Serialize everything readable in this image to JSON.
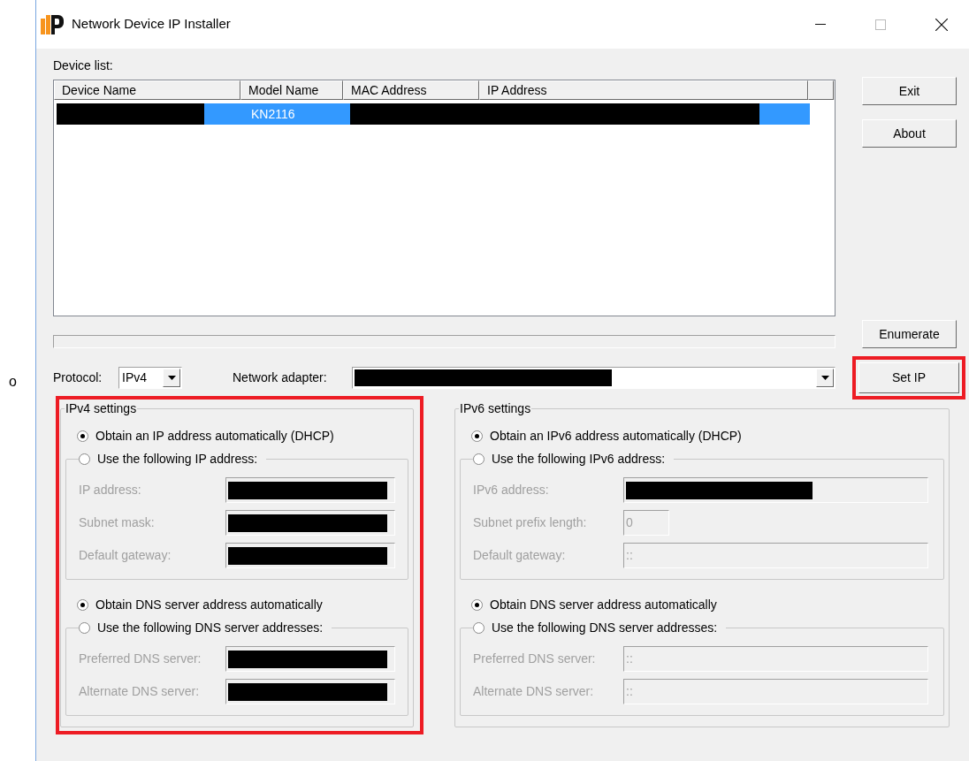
{
  "margin_mark": "o",
  "window": {
    "title": "Network Device IP Installer"
  },
  "device_list": {
    "label": "Device list:",
    "columns": [
      "Device Name",
      "Model Name",
      "MAC Address",
      "IP Address"
    ],
    "rows": [
      {
        "selected": true,
        "cells": [
          {
            "redacted": true
          },
          {
            "text": "KN2116"
          },
          {
            "redacted": true
          },
          {
            "redacted": true
          }
        ]
      }
    ]
  },
  "side_buttons": [
    {
      "label": "Exit"
    },
    {
      "label": "About"
    }
  ],
  "enumerate_button": {
    "label": "Enumerate"
  },
  "protocol": {
    "label": "Protocol:",
    "value": "IPv4"
  },
  "network_adapter": {
    "label": "Network adapter:",
    "redacted": true
  },
  "set_ip_button": {
    "label": "Set IP",
    "highlighted": true
  },
  "ipv4_settings": {
    "title": "IPv4 settings",
    "highlighted": true,
    "address_options": [
      {
        "label": "Obtain an IP address automatically (DHCP)",
        "selected": true
      },
      {
        "label": "Use the following IP address:",
        "selected": false
      }
    ],
    "address_fields": [
      {
        "label": "IP address:",
        "disabled": true,
        "redacted": true
      },
      {
        "label": "Subnet mask:",
        "disabled": true,
        "redacted": true
      },
      {
        "label": "Default gateway:",
        "disabled": true,
        "redacted": true
      }
    ],
    "dns_options": [
      {
        "label": "Obtain DNS server address automatically",
        "selected": true
      },
      {
        "label": "Use the following DNS server addresses:",
        "selected": false
      }
    ],
    "dns_fields": [
      {
        "label": "Preferred DNS server:",
        "disabled": true,
        "redacted": true
      },
      {
        "label": "Alternate DNS server:",
        "disabled": true,
        "redacted": true
      }
    ]
  },
  "ipv6_settings": {
    "title": "IPv6 settings",
    "highlighted": false,
    "address_options": [
      {
        "label": "Obtain an IPv6 address automatically (DHCP)",
        "selected": true
      },
      {
        "label": "Use the following IPv6 address:",
        "selected": false
      }
    ],
    "address_fields": [
      {
        "label": "IPv6 address:",
        "disabled": true,
        "redacted": true
      },
      {
        "label": "Subnet prefix length:",
        "disabled": true,
        "value": "0",
        "kind": "short"
      },
      {
        "label": "Default gateway:",
        "disabled": true,
        "value": "::"
      }
    ],
    "dns_options": [
      {
        "label": "Obtain DNS server address automatically",
        "selected": true
      },
      {
        "label": "Use the following DNS server addresses:",
        "selected": false
      }
    ],
    "dns_fields": [
      {
        "label": "Preferred DNS server:",
        "disabled": true,
        "value": "::"
      },
      {
        "label": "Alternate DNS server:",
        "disabled": true,
        "value": "::"
      }
    ]
  }
}
